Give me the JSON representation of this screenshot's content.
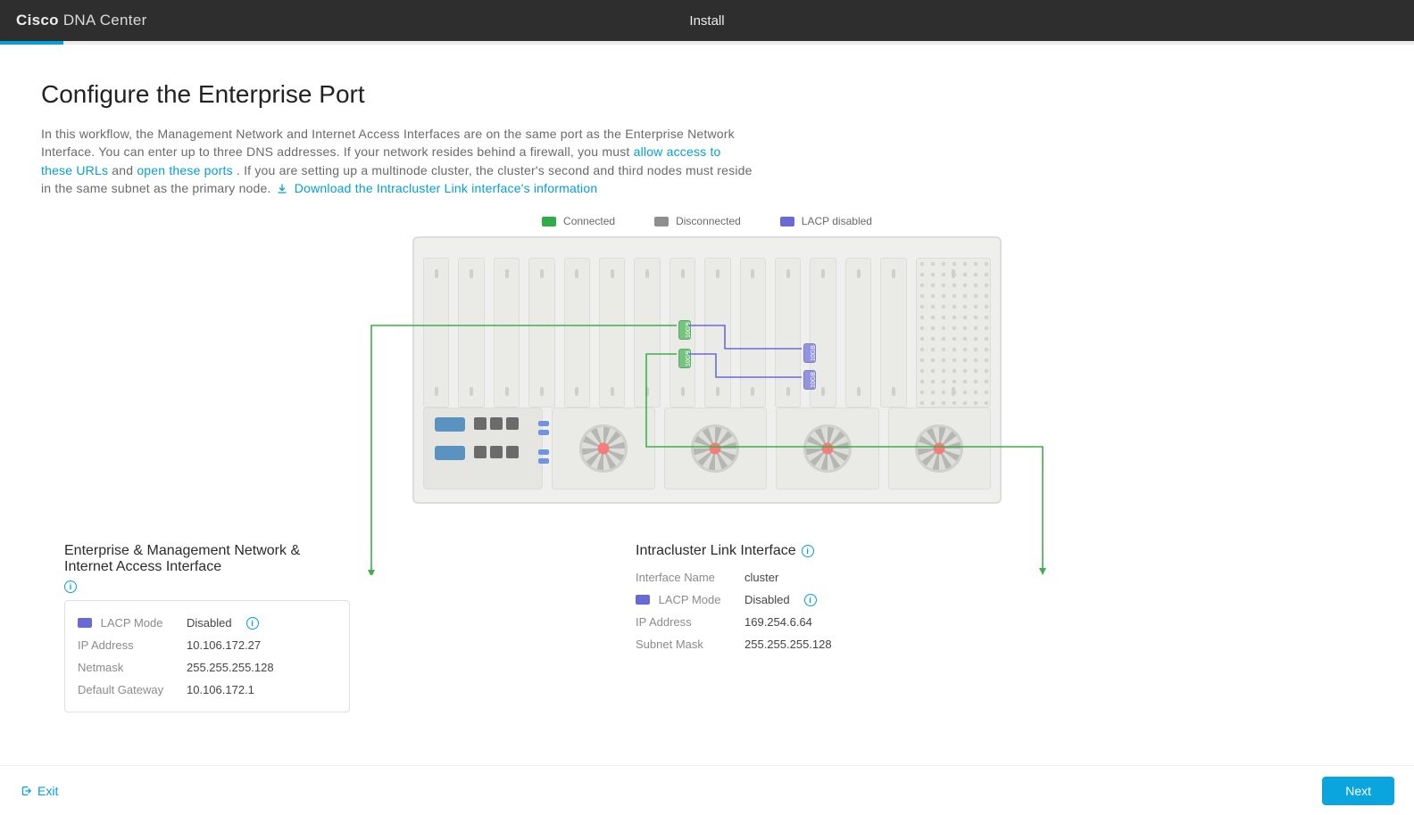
{
  "colors": {
    "accent": "#049fd9",
    "header_bg": "#2e2e2e",
    "connected": "#30ad4a",
    "disconnected": "#8e8e8e",
    "lacp_disabled": "#6a6ad6"
  },
  "header": {
    "brand_bold": "Cisco",
    "brand_thin": "DNA Center",
    "center_title": "Install"
  },
  "progress": {
    "percent": 4.5
  },
  "page_title": "Configure the Enterprise Port",
  "intro": {
    "pre_link1": "In this workflow, the Management Network and Internet Access Interfaces are on the same port as the Enterprise Network Interface. You can enter up to three DNS addresses. If your network resides behind a firewall, you must ",
    "link1": "allow access to these URLs",
    "between_links": " and ",
    "link2": "open these ports",
    "post_link2": ". If you are setting up a multinode cluster, the cluster's second and third nodes must reside in the same subnet as the primary node.  ",
    "download_link": "Download the Intracluster Link interface's information"
  },
  "legend": {
    "connected": "Connected",
    "disconnected": "Disconnected",
    "lacp_disabled": "LACP disabled"
  },
  "port_badges": {
    "g1": "10GB",
    "g2": "10GB",
    "p1": "10GB",
    "p2": "10GB"
  },
  "cards": {
    "enterprise": {
      "title": "Enterprise & Management Network & Internet Access Interface",
      "labels": {
        "lacp_mode": "LACP Mode",
        "ip_address": "IP Address",
        "netmask": "Netmask",
        "default_gateway": "Default Gateway"
      },
      "values": {
        "lacp_mode": "Disabled",
        "ip_address": "10.106.172.27",
        "netmask": "255.255.255.128",
        "default_gateway": "10.106.172.1"
      }
    },
    "intracluster": {
      "title": "Intracluster Link Interface",
      "labels": {
        "interface_name": "Interface Name",
        "lacp_mode": "LACP Mode",
        "ip_address": "IP Address",
        "subnet_mask": "Subnet Mask"
      },
      "values": {
        "interface_name": "cluster",
        "lacp_mode": "Disabled",
        "ip_address": "169.254.6.64",
        "subnet_mask": "255.255.255.128"
      }
    }
  },
  "footer": {
    "exit": "Exit",
    "next": "Next"
  }
}
